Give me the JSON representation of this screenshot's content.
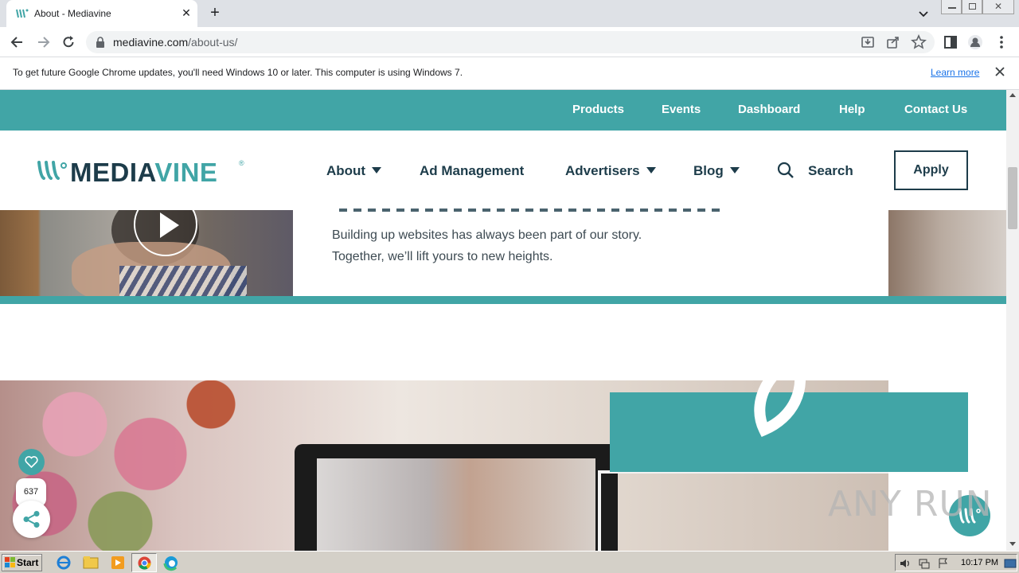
{
  "browser": {
    "tab_title": "About - Mediavine",
    "url_host": "mediavine.com",
    "url_path": "/about-us/"
  },
  "infobar": {
    "message": "To get future Google Chrome updates, you'll need Windows 10 or later. This computer is using Windows 7.",
    "learn_more": "Learn more"
  },
  "top_nav": {
    "links": [
      "Products",
      "Events",
      "Dashboard",
      "Help",
      "Contact Us"
    ]
  },
  "main_nav": {
    "logo_text_a": "MEDIA",
    "logo_text_b": "VINE",
    "items": [
      "About",
      "Ad Management",
      "Advertisers",
      "Blog"
    ],
    "search_label": "Search",
    "apply_label": "Apply"
  },
  "hero": {
    "line1": "Building up websites has always been part of our story.",
    "line2": "Together, we’ll lift yours to new heights."
  },
  "floating": {
    "share_count": "637"
  },
  "watermark": "ANY RUN",
  "taskbar": {
    "start_label": "Start",
    "clock": "10:17 PM"
  },
  "colors": {
    "brand_teal": "#41a5a6",
    "brand_navy": "#1d3c4a"
  }
}
